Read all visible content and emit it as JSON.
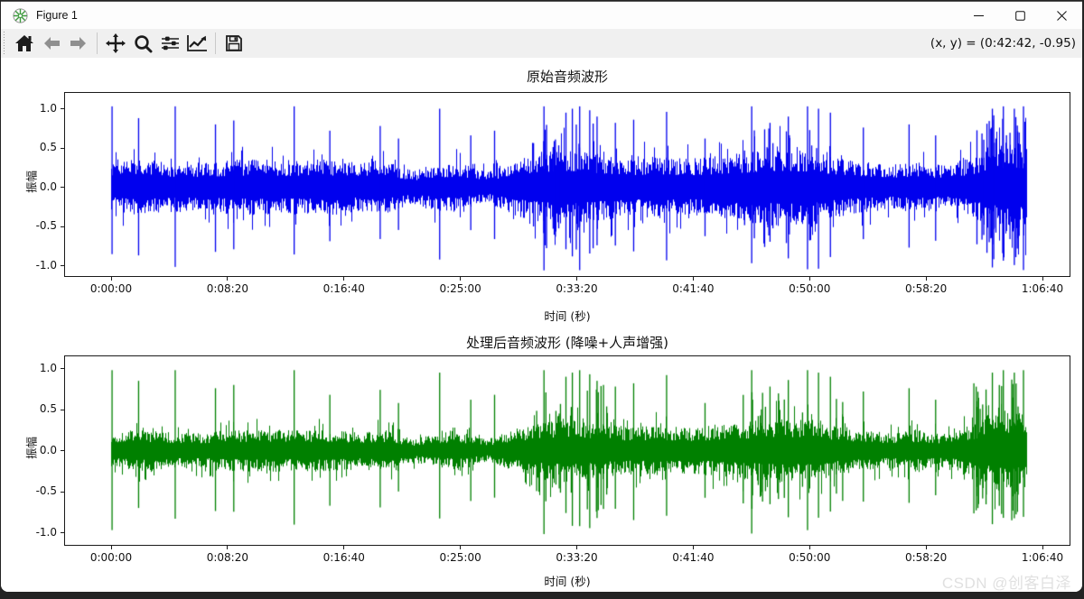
{
  "window": {
    "title": "Figure 1",
    "controls": {
      "minimize": "minimize",
      "maximize": "maximize",
      "close": "close"
    }
  },
  "toolbar": {
    "buttons": [
      {
        "name": "home",
        "icon": "home-icon"
      },
      {
        "name": "back",
        "icon": "arrow-left-icon"
      },
      {
        "name": "forward",
        "icon": "arrow-right-icon"
      },
      {
        "name": "pan",
        "icon": "pan-arrows-icon"
      },
      {
        "name": "zoom",
        "icon": "magnifier-icon"
      },
      {
        "name": "configure-subplots",
        "icon": "sliders-icon"
      },
      {
        "name": "customize-axes",
        "icon": "line-chart-icon"
      },
      {
        "name": "save",
        "icon": "floppy-disk-icon"
      }
    ],
    "coordinate_readout": "(x, y) = (0:42:42, -0.95)"
  },
  "watermark": "CSDN @创客白泽",
  "chart_data": [
    {
      "type": "line",
      "title": "原始音频波形",
      "xlabel": "时间 (秒)",
      "ylabel": "振幅",
      "color": "#0000ee",
      "xticks": [
        "0:00:00",
        "0:08:20",
        "0:16:40",
        "0:25:00",
        "0:33:20",
        "0:41:40",
        "0:50:00",
        "0:58:20",
        "1:06:40"
      ],
      "yticks": [
        "1.0",
        "0.5",
        "0.0",
        "-0.5",
        "-1.0"
      ],
      "ytick_values": [
        1.0,
        0.5,
        0.0,
        -0.5,
        -1.0
      ],
      "ylim": [
        -1.2,
        1.2
      ],
      "tick_interval_seconds": 500,
      "duration_seconds": 3930,
      "grid": false,
      "envelope": [
        [
          0.0,
          0.26
        ],
        [
          0.03,
          0.3
        ],
        [
          0.06,
          0.27
        ],
        [
          0.1,
          0.26
        ],
        [
          0.13,
          0.29
        ],
        [
          0.17,
          0.3
        ],
        [
          0.2,
          0.29
        ],
        [
          0.24,
          0.3
        ],
        [
          0.27,
          0.26
        ],
        [
          0.3,
          0.29
        ],
        [
          0.33,
          0.17
        ],
        [
          0.35,
          0.24
        ],
        [
          0.38,
          0.27
        ],
        [
          0.41,
          0.16
        ],
        [
          0.44,
          0.3
        ],
        [
          0.47,
          0.38
        ],
        [
          0.5,
          0.42
        ],
        [
          0.53,
          0.36
        ],
        [
          0.57,
          0.31
        ],
        [
          0.6,
          0.33
        ],
        [
          0.63,
          0.3
        ],
        [
          0.66,
          0.33
        ],
        [
          0.7,
          0.38
        ],
        [
          0.73,
          0.42
        ],
        [
          0.76,
          0.4
        ],
        [
          0.79,
          0.33
        ],
        [
          0.82,
          0.28
        ],
        [
          0.85,
          0.24
        ],
        [
          0.88,
          0.27
        ],
        [
          0.91,
          0.23
        ],
        [
          0.94,
          0.32
        ],
        [
          0.96,
          0.45
        ],
        [
          0.98,
          0.5
        ],
        [
          1.0,
          0.48
        ]
      ],
      "spikes": [
        [
          0.001,
          1.03
        ],
        [
          0.03,
          0.88
        ],
        [
          0.07,
          1.03
        ],
        [
          0.114,
          0.8
        ],
        [
          0.134,
          0.85
        ],
        [
          0.2,
          1.03
        ],
        [
          0.239,
          0.72
        ],
        [
          0.294,
          0.78
        ],
        [
          0.314,
          0.62
        ],
        [
          0.359,
          1.0
        ],
        [
          0.393,
          0.66
        ],
        [
          0.419,
          0.72
        ],
        [
          0.473,
          1.03
        ],
        [
          0.497,
          0.95
        ],
        [
          0.504,
          1.0
        ],
        [
          0.512,
          1.03
        ],
        [
          0.523,
          0.98
        ],
        [
          0.531,
          0.9
        ],
        [
          0.551,
          0.82
        ],
        [
          0.571,
          0.86
        ],
        [
          0.607,
          0.96
        ],
        [
          0.649,
          0.62
        ],
        [
          0.7,
          1.03
        ],
        [
          0.72,
          0.82
        ],
        [
          0.74,
          0.9
        ],
        [
          0.761,
          1.03
        ],
        [
          0.773,
          1.0
        ],
        [
          0.786,
          0.95
        ],
        [
          0.822,
          0.76
        ],
        [
          0.872,
          0.8
        ],
        [
          0.901,
          0.66
        ],
        [
          0.963,
          1.0
        ],
        [
          0.975,
          1.03
        ],
        [
          0.987,
          1.0
        ],
        [
          0.997,
          1.03
        ]
      ],
      "clusters": [
        [
          0.46,
          0.545,
          14,
          0.85
        ],
        [
          0.69,
          0.8,
          12,
          0.8
        ],
        [
          0.94,
          1.0,
          18,
          0.92
        ]
      ]
    },
    {
      "type": "line",
      "title": "处理后音频波形 (降噪+人声增强)",
      "xlabel": "时间 (秒)",
      "ylabel": "振幅",
      "color": "#008000",
      "xticks": [
        "0:00:00",
        "0:08:20",
        "0:16:40",
        "0:25:00",
        "0:33:20",
        "0:41:40",
        "0:50:00",
        "0:58:20",
        "1:06:40"
      ],
      "yticks": [
        "1.0",
        "0.5",
        "0.0",
        "-0.5",
        "-1.0"
      ],
      "ytick_values": [
        1.0,
        0.5,
        0.0,
        -0.5,
        -1.0
      ],
      "ylim": [
        -1.15,
        1.15
      ],
      "tick_interval_seconds": 500,
      "duration_seconds": 3930,
      "grid": false,
      "envelope": [
        [
          0.0,
          0.18
        ],
        [
          0.03,
          0.22
        ],
        [
          0.06,
          0.19
        ],
        [
          0.1,
          0.18
        ],
        [
          0.13,
          0.21
        ],
        [
          0.17,
          0.22
        ],
        [
          0.2,
          0.21
        ],
        [
          0.24,
          0.22
        ],
        [
          0.27,
          0.19
        ],
        [
          0.3,
          0.21
        ],
        [
          0.33,
          0.12
        ],
        [
          0.35,
          0.17
        ],
        [
          0.38,
          0.2
        ],
        [
          0.41,
          0.11
        ],
        [
          0.44,
          0.22
        ],
        [
          0.47,
          0.3
        ],
        [
          0.5,
          0.34
        ],
        [
          0.53,
          0.28
        ],
        [
          0.57,
          0.24
        ],
        [
          0.6,
          0.26
        ],
        [
          0.63,
          0.23
        ],
        [
          0.66,
          0.26
        ],
        [
          0.7,
          0.3
        ],
        [
          0.73,
          0.34
        ],
        [
          0.76,
          0.32
        ],
        [
          0.79,
          0.26
        ],
        [
          0.82,
          0.21
        ],
        [
          0.85,
          0.18
        ],
        [
          0.88,
          0.21
        ],
        [
          0.91,
          0.17
        ],
        [
          0.94,
          0.26
        ],
        [
          0.96,
          0.38
        ],
        [
          0.98,
          0.42
        ],
        [
          1.0,
          0.4
        ]
      ],
      "spikes": [
        [
          0.001,
          0.98
        ],
        [
          0.03,
          0.85
        ],
        [
          0.07,
          0.98
        ],
        [
          0.114,
          0.76
        ],
        [
          0.134,
          0.8
        ],
        [
          0.2,
          0.98
        ],
        [
          0.239,
          0.68
        ],
        [
          0.294,
          0.74
        ],
        [
          0.314,
          0.58
        ],
        [
          0.359,
          0.95
        ],
        [
          0.393,
          0.62
        ],
        [
          0.419,
          0.68
        ],
        [
          0.473,
          0.98
        ],
        [
          0.497,
          0.9
        ],
        [
          0.504,
          0.95
        ],
        [
          0.512,
          0.98
        ],
        [
          0.523,
          0.93
        ],
        [
          0.531,
          0.85
        ],
        [
          0.551,
          0.78
        ],
        [
          0.571,
          0.82
        ],
        [
          0.607,
          0.92
        ],
        [
          0.649,
          0.58
        ],
        [
          0.7,
          0.98
        ],
        [
          0.72,
          0.78
        ],
        [
          0.74,
          0.86
        ],
        [
          0.761,
          0.98
        ],
        [
          0.773,
          0.95
        ],
        [
          0.786,
          0.9
        ],
        [
          0.822,
          0.72
        ],
        [
          0.872,
          0.76
        ],
        [
          0.901,
          0.62
        ],
        [
          0.963,
          0.95
        ],
        [
          0.975,
          0.98
        ],
        [
          0.987,
          0.95
        ],
        [
          0.997,
          0.98
        ]
      ],
      "clusters": [
        [
          0.46,
          0.545,
          14,
          0.8
        ],
        [
          0.69,
          0.8,
          12,
          0.75
        ],
        [
          0.94,
          1.0,
          18,
          0.88
        ]
      ]
    }
  ]
}
